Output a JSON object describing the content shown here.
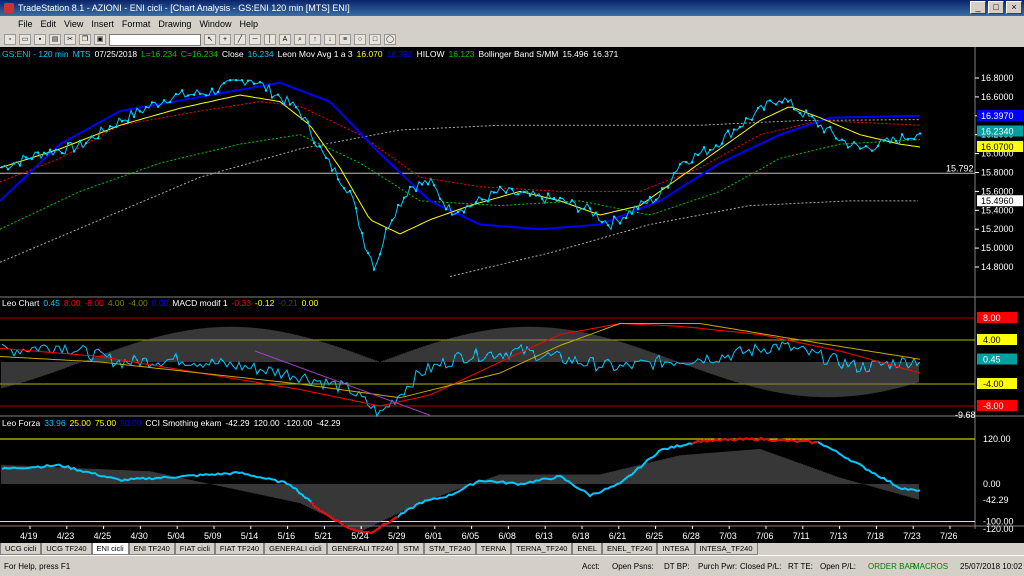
{
  "window": {
    "title": "TradeStation 8.1 - AZIONI - ENI cicli - [Chart Analysis - GS:ENI 120 min [MTS] ENI]"
  },
  "menu": [
    "File",
    "Edit",
    "View",
    "Insert",
    "Format",
    "Drawing",
    "Window",
    "Help"
  ],
  "price_header": {
    "symbol": "GS:ENI - 120 min",
    "mts": "MTS",
    "date": "07/25/2018",
    "low": "L=16.234",
    "close": "C=16.234",
    "close_label": "Close",
    "close_val": "16.234",
    "mov_label": "Leon Mov Avg 1 a 3",
    "mov_val1": "16.070",
    "mov_val2": "16.392",
    "hilow_label": "HILOW",
    "hilow_val": "16.123",
    "boll_label": "Bollinger Band S/MM",
    "boll_val1": "15.496",
    "boll_val2": "16.371"
  },
  "osc_header": {
    "name": "Leo Chart",
    "v1": "0.45",
    "v2": "8.00",
    "v3": "-8.00",
    "v4": "4.00",
    "v5": "-4.00",
    "v6": "0.00",
    "macd_label": "MACD modif 1",
    "m1": "-0.33",
    "m2": "-0.12",
    "m3": "-0.21",
    "m4": "0.00"
  },
  "cci_header": {
    "name": "Leo Forza",
    "v1": "33.96",
    "v2": "25.00",
    "v3": "75.00",
    "v4": "50.00",
    "cci_label": "CCI Smothing ekam",
    "c1": "-42.29",
    "c2": "120.00",
    "c3": "-120.00",
    "c4": "-42.29"
  },
  "price_axis": {
    "ticks": [
      "16.8000",
      "16.6000",
      "16.4000",
      "16.2000",
      "16.0000",
      "15.8000",
      "15.6000",
      "15.4000",
      "15.2000",
      "15.0000",
      "14.8000"
    ],
    "markers": [
      {
        "label": "16.3970",
        "color": "#0000ff",
        "value": 16.397
      },
      {
        "label": "16.2340",
        "color": "#00a0a0",
        "value": 16.234
      },
      {
        "label": "16.0700",
        "color": "#ffff00",
        "value": 16.07
      },
      {
        "label": "15.4960",
        "color": "#ffffff",
        "value": 15.496
      }
    ],
    "hline_label": "15.792"
  },
  "osc_axis": {
    "markers": [
      {
        "label": "8.00",
        "color": "#ff0000",
        "value": 8
      },
      {
        "label": "4.00",
        "color": "#ffff00",
        "value": 4
      },
      {
        "label": "0.45",
        "color": "#00a0a0",
        "value": 0.45
      },
      {
        "label": "-4.00",
        "color": "#ffff00",
        "value": -4
      },
      {
        "label": "-8.00",
        "color": "#ff0000",
        "value": -8
      }
    ],
    "hline_label": "-9.68"
  },
  "cci_axis": {
    "labels": [
      {
        "label": "120.00",
        "value": 120
      },
      {
        "label": "0.00",
        "value": 0
      },
      {
        "label": "-42.29",
        "value": -42.29
      },
      {
        "label": "-100.00",
        "value": -100
      },
      {
        "label": "-120.00",
        "value": -120
      }
    ]
  },
  "dates": [
    "4/19",
    "4/23",
    "4/25",
    "4/30",
    "5/04",
    "5/09",
    "5/14",
    "5/16",
    "5/21",
    "5/24",
    "5/29",
    "6/01",
    "6/05",
    "6/08",
    "6/13",
    "6/18",
    "6/21",
    "6/25",
    "6/28",
    "7/03",
    "7/06",
    "7/11",
    "7/13",
    "7/18",
    "7/23",
    "7/26"
  ],
  "tabs": [
    "UCG cicli",
    "UCG TF240",
    "ENI cicli",
    "ENI TF240",
    "FIAT cicli",
    "FIAT TF240",
    "GENERALI cicli",
    "GENERALI TF240",
    "STM",
    "STM_TF240",
    "TERNA",
    "TERNA_TF240",
    "ENEL",
    "ENEL_TF240",
    "INTESA",
    "INTESA_TF240"
  ],
  "active_tab": "ENI cicli",
  "status": {
    "help": "For Help, press F1",
    "acct": "Acct:",
    "open_psns": "Open Psns:",
    "dt_bp": "DT BP:",
    "purch_pwr": "Purch Pwr:",
    "closed_pl": "Closed P/L:",
    "rt_te": "RT TE:",
    "open_pl": "Open P/L:",
    "order_bar": "ORDER BAR",
    "macros": "MACROS",
    "datetime": "25/07/2018 10:02"
  },
  "colors": {
    "close": "#00c8ff",
    "mov": "#ffff00",
    "bollinger": "#0000ff",
    "hilow": "#ff0000",
    "green": "#00c800"
  }
}
